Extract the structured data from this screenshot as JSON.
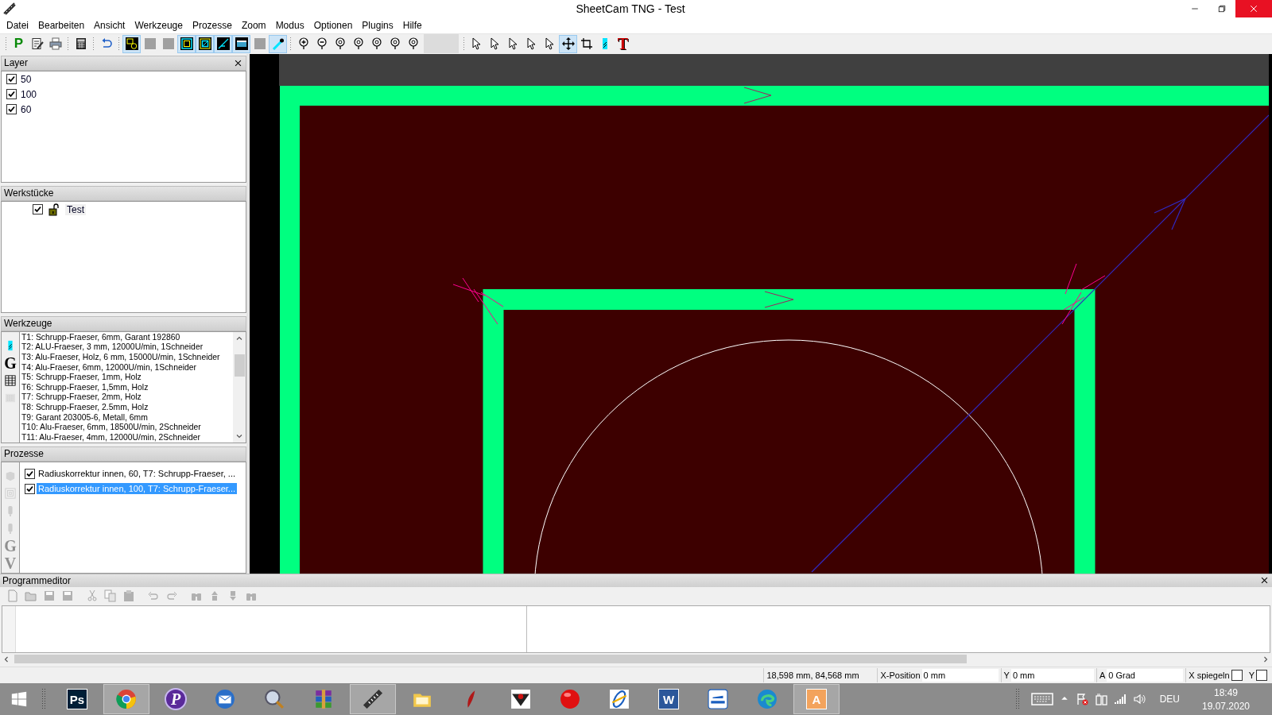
{
  "window": {
    "title": "SheetCam TNG - Test"
  },
  "menu": [
    "Datei",
    "Bearbeiten",
    "Ansicht",
    "Werkzeuge",
    "Prozesse",
    "Zoom",
    "Modus",
    "Optionen",
    "Plugins",
    "Hilfe"
  ],
  "toolbar": [
    {
      "kind": "grip"
    },
    {
      "kind": "letter",
      "label": "P",
      "pressed": false
    },
    {
      "kind": "edit",
      "pressed": false
    },
    {
      "kind": "print",
      "pressed": false
    },
    {
      "kind": "grip"
    },
    {
      "kind": "calc",
      "pressed": false
    },
    {
      "kind": "grip"
    },
    {
      "kind": "undo",
      "pressed": false
    },
    {
      "kind": "grip"
    },
    {
      "kind": "shapes",
      "pressed": true
    },
    {
      "kind": "square",
      "pressed": false
    },
    {
      "kind": "square",
      "pressed": false
    },
    {
      "kind": "outer",
      "pressed": true
    },
    {
      "kind": "inner",
      "pressed": true
    },
    {
      "kind": "line",
      "pressed": true
    },
    {
      "kind": "window",
      "pressed": true
    },
    {
      "kind": "square",
      "pressed": false
    },
    {
      "kind": "stylus",
      "pressed": true
    },
    {
      "kind": "grip"
    },
    {
      "kind": "zoomin",
      "pressed": false
    },
    {
      "kind": "zoomout",
      "pressed": false
    },
    {
      "kind": "pin",
      "pressed": false
    },
    {
      "kind": "pin",
      "pressed": false
    },
    {
      "kind": "pin",
      "pressed": false
    },
    {
      "kind": "pin",
      "pressed": false
    },
    {
      "kind": "pin",
      "pressed": false
    },
    {
      "kind": "blank"
    },
    {
      "kind": "grip"
    },
    {
      "kind": "pointer",
      "pressed": false
    },
    {
      "kind": "pointer",
      "pressed": false
    },
    {
      "kind": "pointer",
      "pressed": false
    },
    {
      "kind": "pointer",
      "pressed": false
    },
    {
      "kind": "pointer",
      "pressed": false
    },
    {
      "kind": "move",
      "pressed": true
    },
    {
      "kind": "crop",
      "pressed": false
    },
    {
      "kind": "tool",
      "pressed": false
    },
    {
      "kind": "letter",
      "label": "T",
      "pressed": false
    }
  ],
  "layers": {
    "title": "Layer",
    "items": [
      {
        "label": "50",
        "checked": true
      },
      {
        "label": "100",
        "checked": true
      },
      {
        "label": "60",
        "checked": true
      }
    ]
  },
  "workpieces": {
    "title": "Werkstücke",
    "items": [
      {
        "label": "Test",
        "checked": true,
        "locked": false
      }
    ]
  },
  "tools": {
    "title": "Werkzeuge",
    "side_buttons": [
      {
        "kind": "tool",
        "disabled": false
      },
      {
        "kind": "letter",
        "label": "G",
        "disabled": false
      },
      {
        "kind": "table",
        "disabled": false
      },
      {
        "kind": "list",
        "disabled": true
      }
    ],
    "items": [
      "T1: Schrupp-Fraeser, 6mm, Garant 192860",
      "T2: ALU-Fraeser, 3 mm, 12000U/min, 1Schneider",
      "T3: Alu-Fraeser, Holz, 6 mm, 15000U/min, 1Schneider",
      "T4: Alu-Fraeser, 6mm, 12000U/min, 1Schneider",
      "T5: Schrupp-Fraeser, 1mm, Holz",
      "T6: Schrupp-Fraeser, 1,5mm, Holz",
      "T7: Schrupp-Fraeser, 2mm, Holz",
      "T8: Schrupp-Fraeser, 2.5mm, Holz",
      "T9: Garant 203005-6, Metall, 6mm",
      "T10: Alu-Fraeser, 6mm, 18500U/min, 2Schneider",
      "T11: Alu-Fraeser, 4mm, 12000U/min, 2Schneider"
    ]
  },
  "processes": {
    "title": "Prozesse",
    "side_buttons": [
      {
        "kind": "cube",
        "disabled": true
      },
      {
        "kind": "spiral",
        "disabled": true
      },
      {
        "kind": "drill",
        "disabled": true
      },
      {
        "kind": "drill",
        "disabled": true
      },
      {
        "kind": "letter",
        "label": "G",
        "disabled": true
      },
      {
        "kind": "letter",
        "label": "V",
        "disabled": true
      }
    ],
    "items": [
      {
        "label": "Radiuskorrektur innen, 60, T7: Schrupp-Fraeser, ...",
        "checked": true,
        "selected": false
      },
      {
        "label": "Radiuskorrektur innen, 100, T7: Schrupp-Fraeser...",
        "checked": true,
        "selected": true
      }
    ]
  },
  "editor": {
    "title": "Programmeditor",
    "toolbar": [
      {
        "kind": "new",
        "disabled": true
      },
      {
        "kind": "open",
        "disabled": true
      },
      {
        "kind": "save",
        "disabled": true
      },
      {
        "kind": "save",
        "disabled": true
      },
      {
        "kind": "gap"
      },
      {
        "kind": "cut",
        "disabled": true
      },
      {
        "kind": "copy",
        "disabled": true
      },
      {
        "kind": "paste",
        "disabled": true
      },
      {
        "kind": "gap"
      },
      {
        "kind": "undo",
        "disabled": true
      },
      {
        "kind": "redo",
        "disabled": true
      },
      {
        "kind": "gap"
      },
      {
        "kind": "find",
        "disabled": true
      },
      {
        "kind": "up",
        "disabled": true
      },
      {
        "kind": "down",
        "disabled": true
      },
      {
        "kind": "find",
        "disabled": true
      }
    ]
  },
  "status_bar": {
    "coordinates": "18,598 mm, 84,568 mm",
    "x_label": "X-Position",
    "x_value": "0 mm",
    "y_label": "Y",
    "y_value": "0 mm",
    "a_label": "A",
    "a_value": "0 Grad",
    "mirror_x_label": "X spiegeln",
    "mirror_x": false,
    "mirror_y_label": "Y",
    "mirror_y": false
  },
  "taskbar": {
    "apps": [
      {
        "kind": "tile",
        "label": "Ps",
        "color": "#001e36",
        "active": false
      },
      {
        "kind": "rings",
        "active": true
      },
      {
        "kind": "badge",
        "label": "P",
        "active": false
      },
      {
        "kind": "mail",
        "active": false
      },
      {
        "kind": "magnifier",
        "active": false
      },
      {
        "kind": "books",
        "active": false
      },
      {
        "kind": "ruler",
        "active": true
      },
      {
        "kind": "folder",
        "active": false
      },
      {
        "kind": "feather",
        "active": false
      },
      {
        "kind": "shield",
        "active": false
      },
      {
        "kind": "sphere",
        "active": false
      },
      {
        "kind": "orbit",
        "active": false
      },
      {
        "kind": "tile",
        "label": "W",
        "color": "#2b579a",
        "active": false
      },
      {
        "kind": "stapler",
        "active": false
      },
      {
        "kind": "swirl",
        "active": false
      },
      {
        "kind": "tile",
        "label": "A",
        "color": "#f3a35c",
        "active": true
      }
    ],
    "language": "DEU",
    "time": "18:49",
    "date": "19.07.2020"
  }
}
